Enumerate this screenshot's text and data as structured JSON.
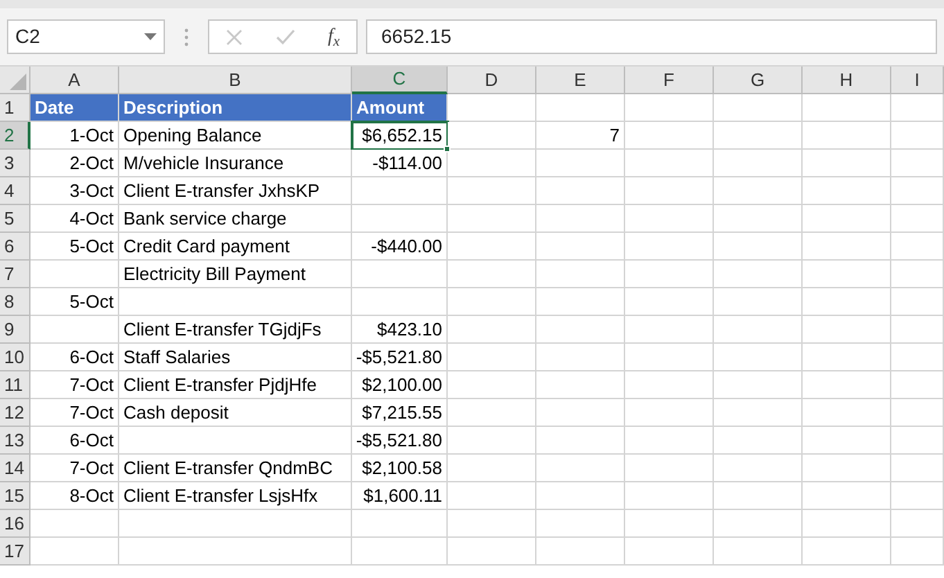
{
  "name_box": {
    "value": "C2"
  },
  "formula_bar": {
    "function_label": "f$_{x}$",
    "value": "6652.15",
    "cancel_disabled": true,
    "enter_disabled": true
  },
  "columns": [
    {
      "label": "A",
      "selected": false
    },
    {
      "label": "B",
      "selected": false
    },
    {
      "label": "C",
      "selected": true
    },
    {
      "label": "D",
      "selected": false
    },
    {
      "label": "E",
      "selected": false
    },
    {
      "label": "F",
      "selected": false
    },
    {
      "label": "G",
      "selected": false
    },
    {
      "label": "H",
      "selected": false
    },
    {
      "label": "I",
      "selected": false
    }
  ],
  "rows": [
    {
      "number": "1",
      "selected": false,
      "kind": "header",
      "cells": {
        "A": "Date",
        "B": "Description",
        "C": "Amount"
      }
    },
    {
      "number": "2",
      "selected": true,
      "kind": "data",
      "cells": {
        "A": "1-Oct",
        "B": "Opening Balance",
        "C": "$6,652.15",
        "E": "7"
      }
    },
    {
      "number": "3",
      "selected": false,
      "kind": "data",
      "cells": {
        "A": "2-Oct",
        "B": "M/vehicle Insurance",
        "C": "-$114.00"
      }
    },
    {
      "number": "4",
      "selected": false,
      "kind": "data",
      "cells": {
        "A": "3-Oct",
        "B": "Client E-transfer JxhsKP"
      }
    },
    {
      "number": "5",
      "selected": false,
      "kind": "data",
      "cells": {
        "A": "4-Oct",
        "B": "Bank service charge"
      }
    },
    {
      "number": "6",
      "selected": false,
      "kind": "data",
      "cells": {
        "A": "5-Oct",
        "B": "Credit Card payment",
        "C": "-$440.00"
      }
    },
    {
      "number": "7",
      "selected": false,
      "kind": "data",
      "cells": {
        "B": "Electricity Bill Payment"
      }
    },
    {
      "number": "8",
      "selected": false,
      "kind": "data",
      "cells": {
        "A": "5-Oct"
      }
    },
    {
      "number": "9",
      "selected": false,
      "kind": "data",
      "cells": {
        "B": "Client E-transfer TGjdjFs",
        "C": "$423.10"
      }
    },
    {
      "number": "10",
      "selected": false,
      "kind": "data",
      "cells": {
        "A": "6-Oct",
        "B": "Staff Salaries",
        "C": "-$5,521.80"
      }
    },
    {
      "number": "11",
      "selected": false,
      "kind": "data",
      "cells": {
        "A": "7-Oct",
        "B": "Client E-transfer PjdjHfe",
        "C": "$2,100.00"
      }
    },
    {
      "number": "12",
      "selected": false,
      "kind": "data",
      "cells": {
        "A": "7-Oct",
        "B": "Cash deposit",
        "C": "$7,215.55"
      }
    },
    {
      "number": "13",
      "selected": false,
      "kind": "data",
      "cells": {
        "A": "6-Oct",
        "C": "-$5,521.80"
      }
    },
    {
      "number": "14",
      "selected": false,
      "kind": "data",
      "cells": {
        "A": "7-Oct",
        "B": "Client E-transfer QndmBC",
        "C": "$2,100.58"
      }
    },
    {
      "number": "15",
      "selected": false,
      "kind": "data",
      "cells": {
        "A": "8-Oct",
        "B": "Client E-transfer LsjsHfx",
        "C": "$1,600.11"
      }
    },
    {
      "number": "16",
      "selected": false,
      "kind": "data",
      "cells": {}
    },
    {
      "number": "17",
      "selected": false,
      "kind": "data",
      "cells": {}
    }
  ]
}
